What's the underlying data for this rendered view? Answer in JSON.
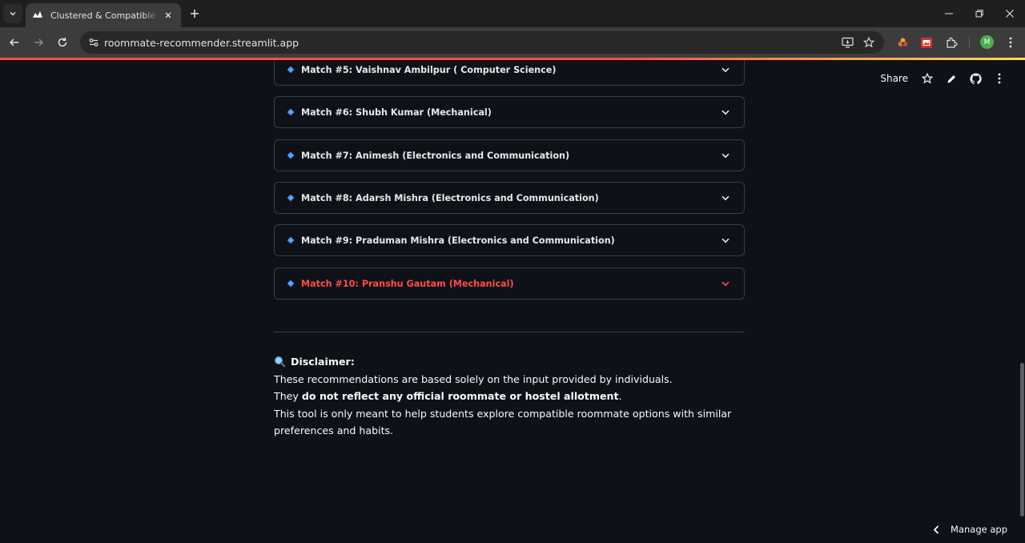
{
  "browser": {
    "tab_title": "Clustered & Compatible · Streamlit",
    "url": "roommate-recommender.streamlit.app",
    "profile_initial": "M"
  },
  "header": {
    "share_label": "Share"
  },
  "matches": [
    {
      "label": "Match #5: Vaishnav Ambilpur ( Computer Science)",
      "active": false
    },
    {
      "label": "Match #6: Shubh Kumar (Mechanical)",
      "active": false
    },
    {
      "label": "Match #7: Animesh (Electronics and Communication)",
      "active": false
    },
    {
      "label": "Match #8: Adarsh Mishra (Electronics and Communication)",
      "active": false
    },
    {
      "label": "Match #9: Praduman Mishra (Electronics and Communication)",
      "active": false
    },
    {
      "label": "Match #10: Pranshu Gautam (Mechanical)",
      "active": true
    }
  ],
  "disclaimer": {
    "title": "Disclaimer:",
    "line1": "These recommendations are based solely on the input provided by individuals.",
    "line2_pre": "They ",
    "line2_bold": "do not reflect any official roommate or hostel allotment",
    "line2_post": ".",
    "line3": "This tool is only meant to help students explore compatible roommate options with similar preferences and habits."
  },
  "footer": {
    "manage_app_label": "Manage app"
  },
  "colors": {
    "accent": "#ff4b4b",
    "bullet": "#4ea3ff",
    "background": "#0e1117"
  }
}
